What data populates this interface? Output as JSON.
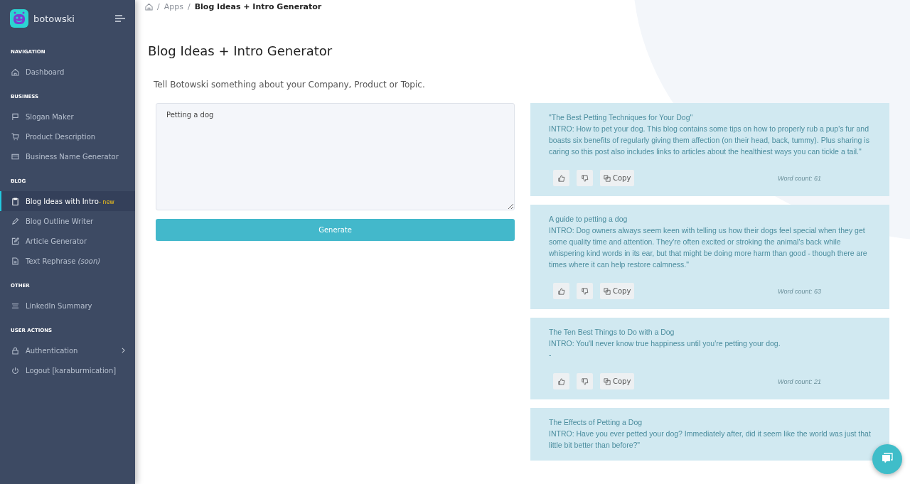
{
  "brand": {
    "name": "botowski"
  },
  "sidebar": {
    "sections": [
      {
        "heading": "NAVIGATION",
        "items": [
          {
            "label": "Dashboard",
            "selected": false
          }
        ]
      },
      {
        "heading": "BUSINESS",
        "items": [
          {
            "label": "Slogan Maker",
            "selected": false
          },
          {
            "label": "Product Description",
            "selected": false
          },
          {
            "label": "Business Name Generator",
            "selected": false
          }
        ]
      },
      {
        "heading": "BLOG",
        "items": [
          {
            "label": "Blog Ideas with Intro",
            "badge": "- new",
            "selected": true
          },
          {
            "label": "Blog Outline Writer",
            "selected": false
          },
          {
            "label": "Article Generator",
            "selected": false
          },
          {
            "label": "Text Rephrase *(soon)*",
            "selected": false
          }
        ]
      },
      {
        "heading": "OTHER",
        "items": [
          {
            "label": "LinkedIn Summary",
            "selected": false
          }
        ]
      },
      {
        "heading": "USER ACTIONS",
        "items": [
          {
            "label": "Authentication",
            "selected": false,
            "submenu": true
          },
          {
            "label": "Logout [karaburmication]",
            "selected": false
          }
        ]
      }
    ]
  },
  "breadcrumb": {
    "separator": "/",
    "items": [
      "Apps"
    ],
    "current": "Blog Ideas + Intro Generator"
  },
  "page_title": "Blog Ideas + Intro Generator",
  "prompt": "Tell Botowski something about your Company, Product or Topic.",
  "topic_field": {
    "value": "Petting a dog"
  },
  "generate_button": "Generate",
  "results": [
    {
      "title": "\"The Best Petting Techniques for Your Dog\"",
      "lines": [
        "INTRO:  How to pet your dog. This blog contains some tips on how to properly rub a pup's fur and boasts six benefits of regularly giving them affection (on their head, back, tummy). Plus sharing is caring so this post also includes links to articles about the healthiest ways you can tickle a tail.\""
      ],
      "copy": "Copy",
      "word_count": "Word count: 61"
    },
    {
      "title": "A guide to petting a dog",
      "lines": [
        "INTRO: Dog owners always seem keen with telling us how their dogs feel special when they get some quality time and attention. They're often excited or stroking the animal's back while whispering kind words in its ear, but that might be doing more harm than good - though there are times where it can help restore calmness.\""
      ],
      "copy": "Copy",
      "word_count": "Word count: 63"
    },
    {
      "title": "The Ten Best Things to Do with a Dog",
      "lines": [
        "INTRO: You'll never know true happiness until you're petting your dog.",
        "-"
      ],
      "copy": "Copy",
      "word_count": "Word count: 21"
    },
    {
      "title": "The Effects of Petting a Dog",
      "lines": [
        "INTRO: Have you ever petted your dog? Immediately after, did it seem like the world was just that little bit better than before?\""
      ]
    }
  ]
}
